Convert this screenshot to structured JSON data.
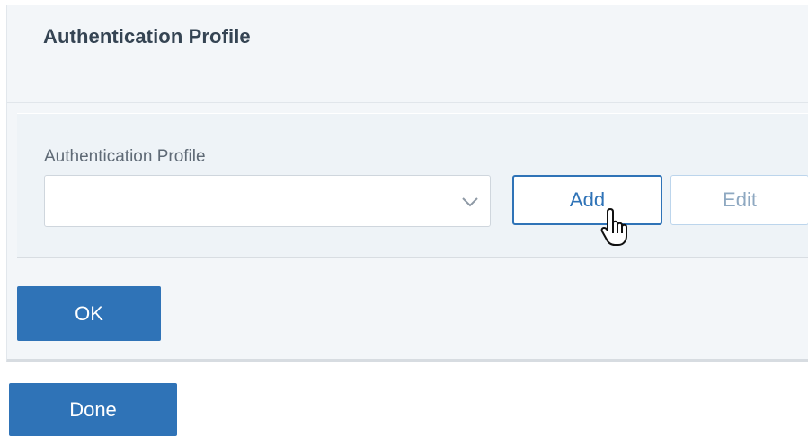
{
  "panel": {
    "title": "Authentication Profile"
  },
  "form": {
    "field_label": "Authentication Profile",
    "select_value": "",
    "add_label": "Add",
    "edit_label": "Edit"
  },
  "actions": {
    "ok_label": "OK",
    "done_label": "Done"
  },
  "icons": {
    "select_indicator": "chevron-down-icon",
    "pointer": "hand-pointer-cursor-icon"
  },
  "colors": {
    "primary": "#2f73b7",
    "panel_background": "#f3f6f9",
    "section_background": "#eef3f7",
    "title_text": "#354453",
    "label_text": "#5f6a76",
    "disabled_border": "#bcd5ec"
  }
}
